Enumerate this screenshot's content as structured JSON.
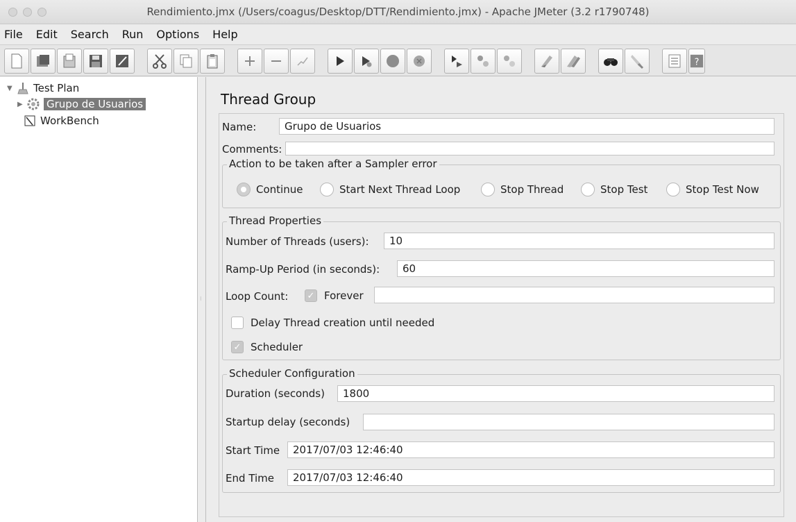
{
  "window": {
    "title": "Rendimiento.jmx (/Users/coagus/Desktop/DTT/Rendimiento.jmx) - Apache JMeter (3.2 r1790748)"
  },
  "menu": [
    "File",
    "Edit",
    "Search",
    "Run",
    "Options",
    "Help"
  ],
  "toolbar": {
    "buttons": [
      "new-icon",
      "templates-icon",
      "open-icon",
      "save-icon",
      "save-as-icon",
      "cut-icon",
      "copy-icon",
      "paste-icon",
      "expand-icon",
      "collapse-icon",
      "toggle-icon",
      "start-icon",
      "start-no-pauses-icon",
      "stop-icon",
      "shutdown-icon",
      "remote-start-icon",
      "remote-stop-icon",
      "remote-shutdown-icon",
      "clear-icon",
      "clear-all-icon",
      "search-icon",
      "reset-search-icon",
      "function-helper-icon",
      "help-icon"
    ]
  },
  "tree": {
    "test_plan": "Test Plan",
    "thread_group": "Grupo de Usuarios",
    "workbench": "WorkBench"
  },
  "panel": {
    "title": "Thread Group",
    "name_label": "Name:",
    "name_value": "Grupo de Usuarios",
    "comments_label": "Comments:",
    "comments_value": "",
    "action_group": {
      "legend": "Action to be taken after a Sampler error",
      "options": [
        "Continue",
        "Start Next Thread Loop",
        "Stop Thread",
        "Stop Test",
        "Stop Test Now"
      ],
      "selected": "Continue"
    },
    "thread_properties": {
      "legend": "Thread Properties",
      "threads_label": "Number of Threads (users):",
      "threads_value": "10",
      "rampup_label": "Ramp-Up Period (in seconds):",
      "rampup_value": "60",
      "loop_label": "Loop Count:",
      "forever_label": "Forever",
      "forever_checked": true,
      "loop_value": "",
      "delay_label": "Delay Thread creation until needed",
      "delay_checked": false,
      "scheduler_label": "Scheduler",
      "scheduler_checked": true
    },
    "scheduler": {
      "legend": "Scheduler Configuration",
      "duration_label": "Duration (seconds)",
      "duration_value": "1800",
      "startup_label": "Startup delay (seconds)",
      "startup_value": "",
      "start_label": "Start Time",
      "start_value": "2017/07/03 12:46:40",
      "end_label": "End Time",
      "end_value": "2017/07/03 12:46:40"
    }
  }
}
